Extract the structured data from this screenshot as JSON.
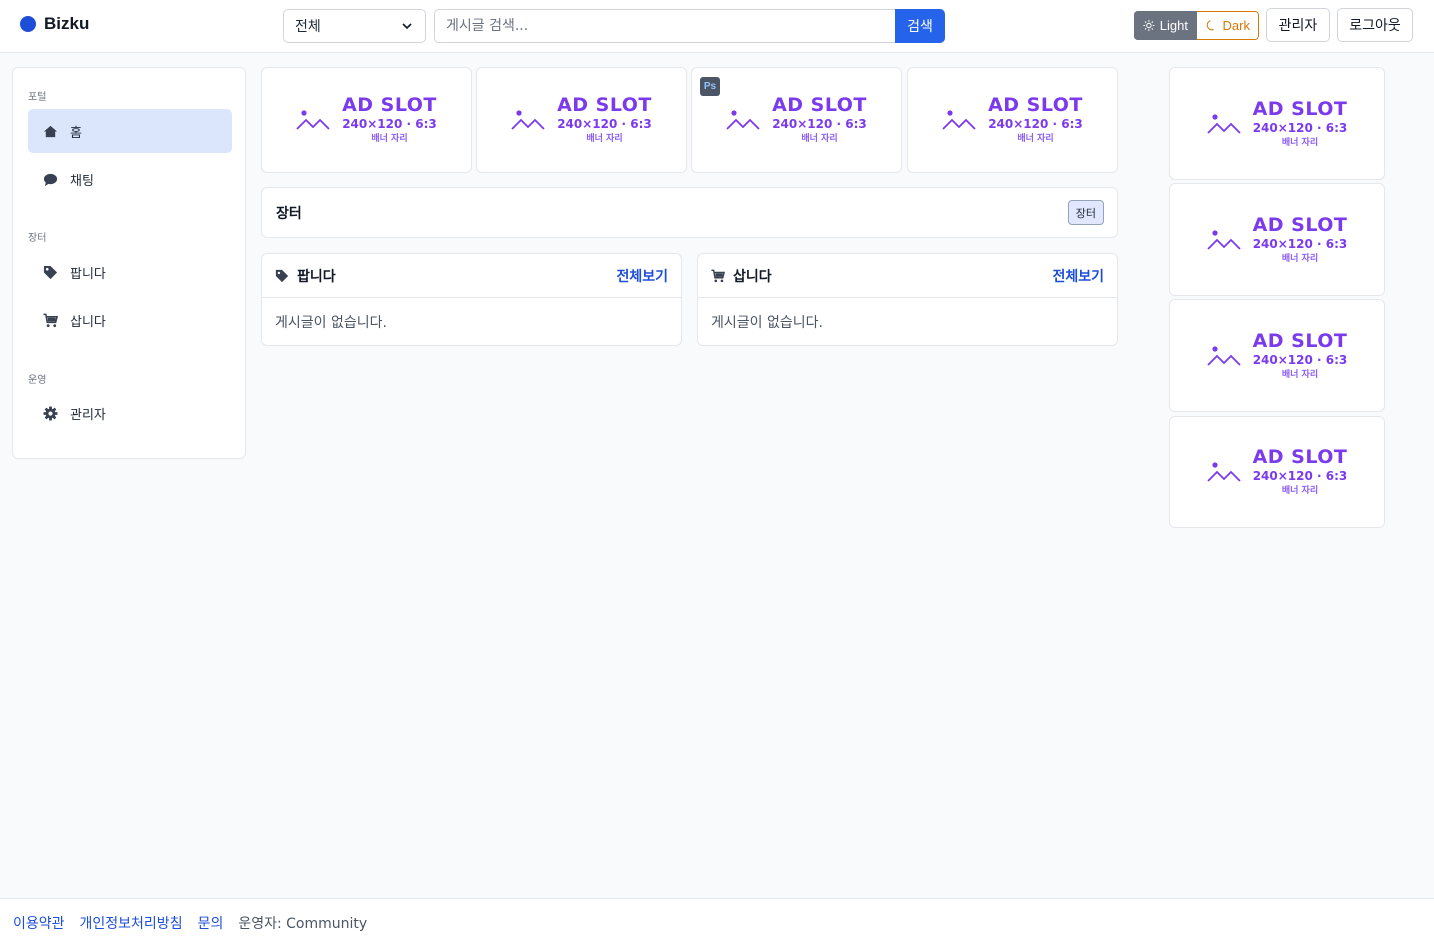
{
  "header": {
    "brand": "Bizku",
    "category_selected": "전체",
    "search_placeholder": "게시글 검색...",
    "search_button": "검색",
    "theme_light": "Light",
    "theme_dark": "Dark",
    "admin_button": "관리자",
    "logout_button": "로그아웃"
  },
  "sidebar": {
    "sections": [
      {
        "label": "포털",
        "items": [
          {
            "label": "홈",
            "icon": "home-icon",
            "active": true
          },
          {
            "label": "채팅",
            "icon": "chat-icon"
          }
        ]
      },
      {
        "label": "장터",
        "items": [
          {
            "label": "팝니다",
            "icon": "tag-icon"
          },
          {
            "label": "삽니다",
            "icon": "cart-icon"
          }
        ]
      },
      {
        "label": "운영",
        "items": [
          {
            "label": "관리자",
            "icon": "gear-icon"
          }
        ]
      }
    ]
  },
  "ads": {
    "title": "AD SLOT",
    "size": "240×120 · 6:3",
    "sub": "배너 자리",
    "badge": "Ps"
  },
  "market": {
    "title": "장터",
    "badge": "장터",
    "sell": {
      "title": "팝니다",
      "link": "전체보기",
      "empty": "게시글이 없습니다."
    },
    "buy": {
      "title": "삽니다",
      "link": "전체보기",
      "empty": "게시글이 없습니다."
    }
  },
  "footer": {
    "terms": "이용약관",
    "privacy": "개인정보처리방침",
    "contact": "문의",
    "operator": "운영자: Community"
  },
  "colors": {
    "accent": "#2563eb",
    "ad": "#7c3aed",
    "active_bg": "#dbe6fd"
  }
}
